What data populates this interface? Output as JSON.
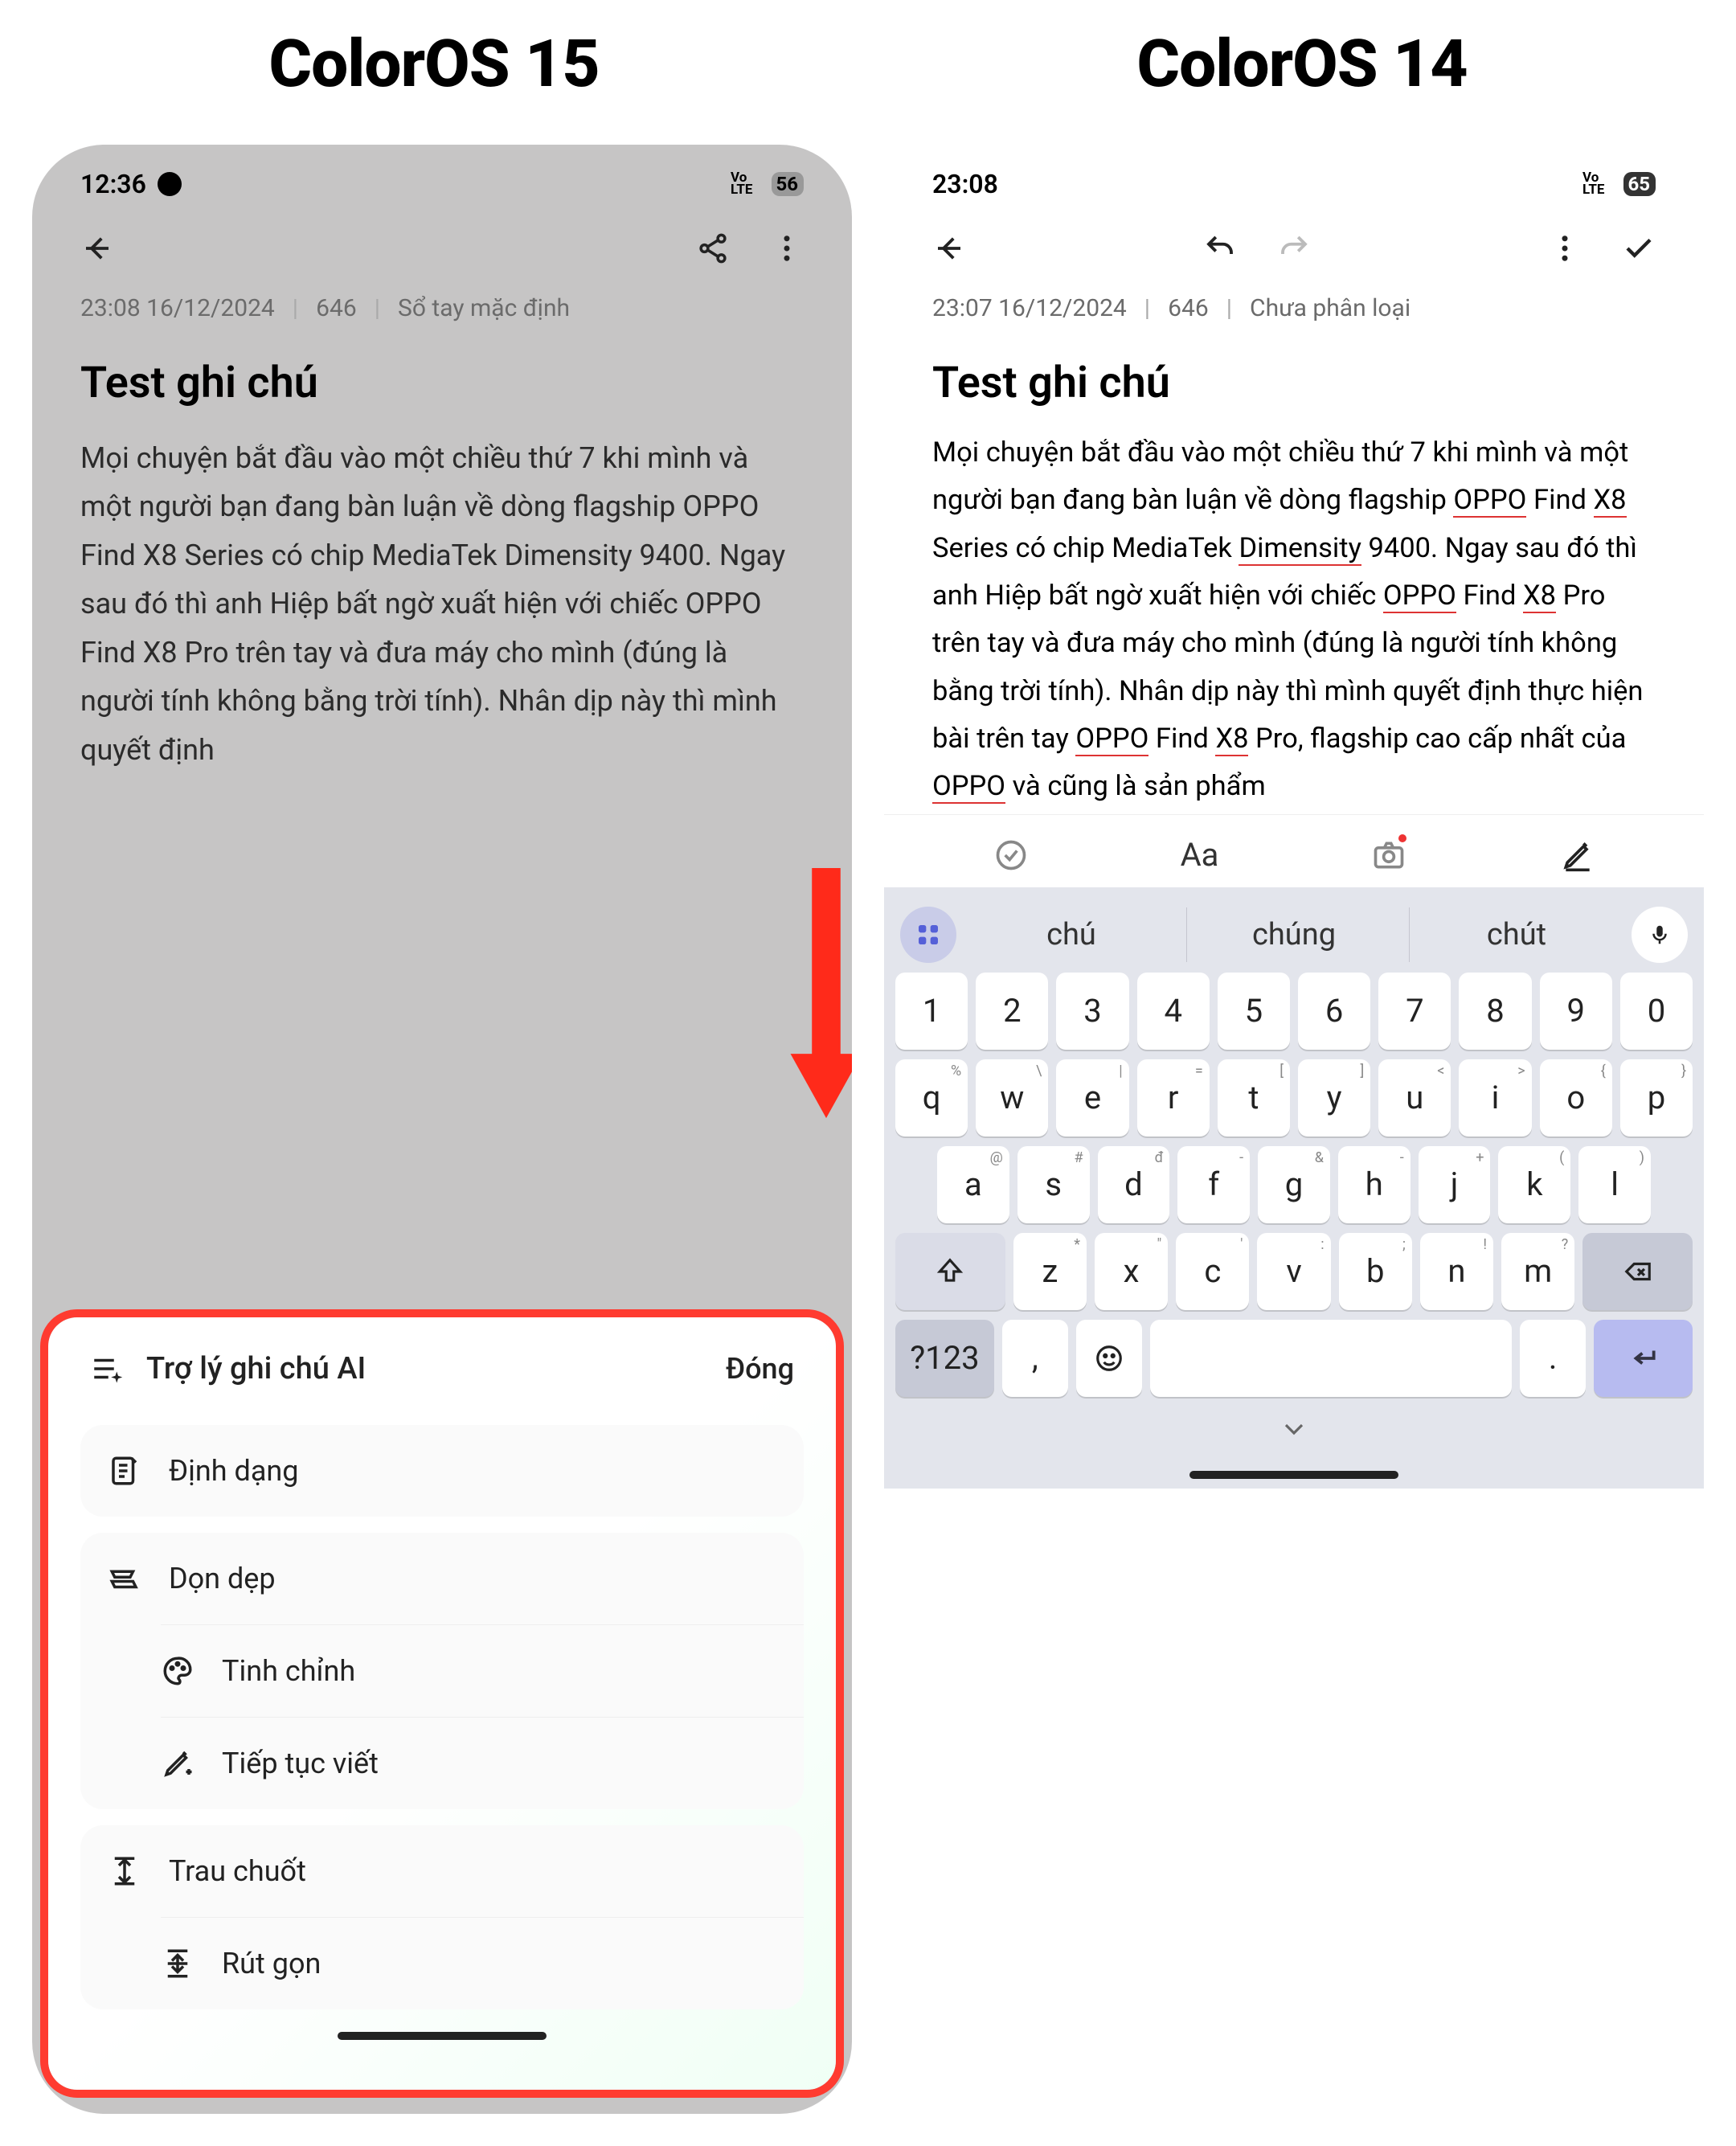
{
  "headers": {
    "left": "ColorOS 15",
    "right": "ColorOS 14"
  },
  "left": {
    "status": {
      "time": "12:36",
      "battery": "56"
    },
    "meta": {
      "datetime": "23:08 16/12/2024",
      "count": "646",
      "folder": "Sổ tay mặc định"
    },
    "note": {
      "title": "Test ghi chú",
      "body": "Mọi chuyện bắt đầu vào một chiều thứ 7 khi mình và một người bạn đang bàn luận về dòng flagship OPPO Find X8 Series có chip MediaTek Dimensity 9400. Ngay sau đó thì anh Hiệp bất ngờ xuất hiện với chiếc OPPO Find X8 Pro trên tay và đưa máy cho mình (đúng là người tính không bằng trời tính). Nhân dịp này thì mình quyết định"
    },
    "ai": {
      "title": "Trợ lý ghi chú AI",
      "close": "Đóng",
      "items": {
        "format": "Định dạng",
        "cleanup": "Dọn dẹp",
        "tune": "Tinh chỉnh",
        "continue": "Tiếp tục viết",
        "polish": "Trau chuốt",
        "shorten": "Rút gọn"
      }
    }
  },
  "right": {
    "status": {
      "time": "23:08",
      "battery": "65"
    },
    "meta": {
      "datetime": "23:07 16/12/2024",
      "count": "646",
      "folder": "Chưa phân loại"
    },
    "note": {
      "title": "Test ghi chú",
      "body_parts": [
        {
          "t": "Mọi chuyện bắt đầu vào một chiều thứ 7 khi mình và một người bạn đang bàn luận về dòng flagship "
        },
        {
          "t": "OPPO",
          "u": true
        },
        {
          "t": " Find "
        },
        {
          "t": "X8",
          "u": true
        },
        {
          "t": " Series có chip MediaTek "
        },
        {
          "t": "Dimensity",
          "u": true
        },
        {
          "t": " 9400. Ngay sau đó thì anh Hiệp bất ngờ xuất hiện với chiếc "
        },
        {
          "t": "OPPO",
          "u": true
        },
        {
          "t": " Find "
        },
        {
          "t": "X8",
          "u": true
        },
        {
          "t": " Pro trên tay và đưa máy cho mình (đúng là người tính không bằng trời tính). Nhân dịp này thì mình quyết định thực hiện bài trên tay "
        },
        {
          "t": "OPPO",
          "u": true
        },
        {
          "t": " Find "
        },
        {
          "t": "X8",
          "u": true
        },
        {
          "t": " Pro, flagship cao cấp nhất của "
        },
        {
          "t": "OPPO",
          "u": true
        },
        {
          "t": " và cũng là sản phẩm"
        }
      ]
    },
    "editorbar": {
      "text_label": "Aa"
    },
    "kb": {
      "suggestions": [
        "chú",
        "chúng",
        "chút"
      ],
      "row1": [
        "1",
        "2",
        "3",
        "4",
        "5",
        "6",
        "7",
        "8",
        "9",
        "0"
      ],
      "row2": [
        {
          "k": "q",
          "s": "%"
        },
        {
          "k": "w",
          "s": "\\"
        },
        {
          "k": "e",
          "s": "|"
        },
        {
          "k": "r",
          "s": "="
        },
        {
          "k": "t",
          "s": "["
        },
        {
          "k": "y",
          "s": "]"
        },
        {
          "k": "u",
          "s": "<"
        },
        {
          "k": "i",
          "s": ">"
        },
        {
          "k": "o",
          "s": "{"
        },
        {
          "k": "p",
          "s": "}"
        }
      ],
      "row3": [
        {
          "k": "a",
          "s": "@"
        },
        {
          "k": "s",
          "s": "#"
        },
        {
          "k": "d",
          "s": "đ"
        },
        {
          "k": "f",
          "s": "-"
        },
        {
          "k": "g",
          "s": "&"
        },
        {
          "k": "h",
          "s": "-"
        },
        {
          "k": "j",
          "s": "+"
        },
        {
          "k": "k",
          "s": "("
        },
        {
          "k": "l",
          "s": ")"
        }
      ],
      "row4": [
        {
          "k": "z",
          "s": "*"
        },
        {
          "k": "x",
          "s": "\""
        },
        {
          "k": "c",
          "s": "'"
        },
        {
          "k": "v",
          "s": ":"
        },
        {
          "k": "b",
          "s": ";"
        },
        {
          "k": "n",
          "s": "!"
        },
        {
          "k": "m",
          "s": "?"
        }
      ],
      "sym_key": "?123",
      "comma": ",",
      "period": "."
    }
  }
}
